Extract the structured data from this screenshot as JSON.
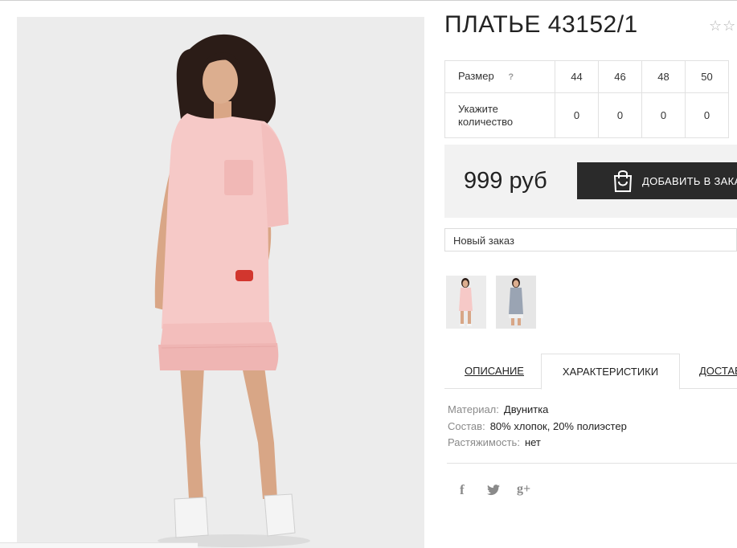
{
  "product": {
    "title": "ПЛАТЬЕ 43152/1",
    "rating_stars": "☆☆"
  },
  "size_table": {
    "size_label": "Размер",
    "help_symbol": "?",
    "sizes": [
      "44",
      "46",
      "48",
      "50"
    ],
    "qty_label": "Укажите количество",
    "quantities": [
      "0",
      "0",
      "0",
      "0"
    ]
  },
  "price": {
    "value": "999 руб",
    "add_to_cart_label": "ДОБАВИТЬ В ЗАКАЗ"
  },
  "order": {
    "selected": "Новый заказ"
  },
  "tabs": [
    {
      "label": "ОПИСАНИЕ",
      "active": false
    },
    {
      "label": "ХАРАКТЕРИСТИКИ",
      "active": true
    },
    {
      "label": "ДОСТАВКА",
      "active": false
    }
  ],
  "attributes": [
    {
      "key": "Материал:",
      "value": "Двунитка"
    },
    {
      "key": "Состав:",
      "value": "80% хлопок, 20% полиэстер"
    },
    {
      "key": "Растяжимость:",
      "value": "нет"
    }
  ],
  "social": {
    "facebook": "f",
    "twitter": "🐦",
    "gplus": "g+"
  },
  "colors": {
    "button_dark": "#2a2a2a",
    "price_bg": "#f2f2f2",
    "photo_bg": "#ececec",
    "dress_pink": "#f6c9c7"
  }
}
